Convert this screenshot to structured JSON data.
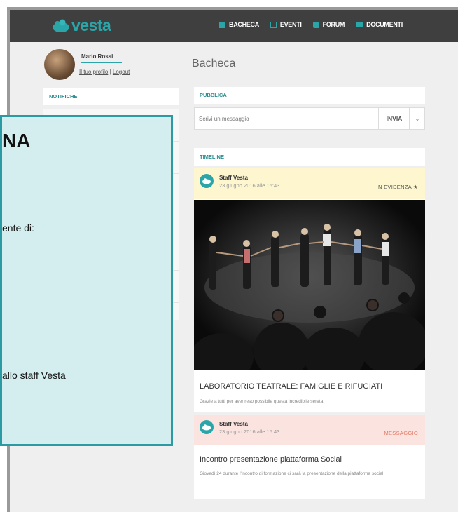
{
  "header": {
    "logo_text": "vesta",
    "nav": [
      {
        "label": "BACHECA",
        "icon": "dashboard-icon"
      },
      {
        "label": "EVENTI",
        "icon": "calendar-icon"
      },
      {
        "label": "FORUM",
        "icon": "chat-icon"
      },
      {
        "label": "DOCUMENTI",
        "icon": "folder-icon"
      }
    ]
  },
  "profile": {
    "name": "Mario Rossi",
    "profile_link": "Il tuo profilo",
    "separator": " | ",
    "logout_link": "Logout"
  },
  "sidebar": {
    "notifications_title": "NOTIFICHE"
  },
  "page": {
    "title": "Bacheca"
  },
  "compose": {
    "section_title": "PUBBLICA",
    "placeholder": "Scrivi un messaggio",
    "send_label": "INVIA",
    "dropdown_glyph": "⌄"
  },
  "timeline": {
    "section_title": "TIMELINE",
    "posts": [
      {
        "author": "Staff Vesta",
        "date": "23 giugno 2016 alle 15:43",
        "tag": "IN EVIDENZA ★",
        "title": "LABORATORIO TEATRALE: FAMIGLIE E RIFUGIATI",
        "text": "Grazie a tutti per aver reso possibile questa incredibile serata!"
      },
      {
        "author": "Staff Vesta",
        "date": "23 giugno 2016 alle 15:43",
        "tag": "MESSAGGIO",
        "title": "Incontro presentazione piattaforma Social",
        "text": "Giovedì 24 durante l'incontro di formazione ci sarà la presentazione della piattaforma social."
      }
    ]
  },
  "overlay": {
    "title_fragment": "NA",
    "line1": "ente di:",
    "line2": "allo staff Vesta"
  },
  "colors": {
    "accent": "#2aa6a9",
    "topbar": "#3f3f3f",
    "featured_bg": "#fdf6cf",
    "message_bg": "#fbe3df",
    "message_tag": "#e57a66",
    "overlay_bg": "#d4eef0",
    "overlay_border": "#2b9aa3"
  }
}
